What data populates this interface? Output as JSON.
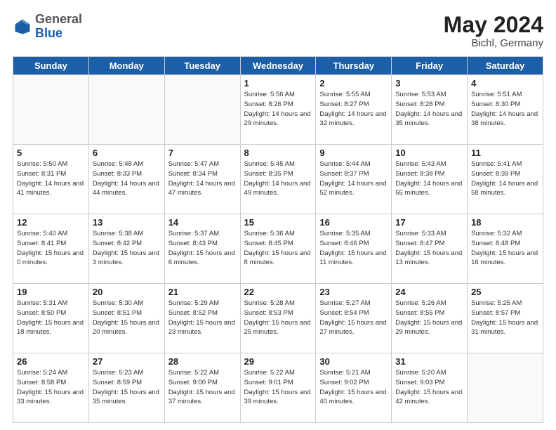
{
  "header": {
    "logo_general": "General",
    "logo_blue": "Blue",
    "month_title": "May 2024",
    "location": "Bichl, Germany"
  },
  "weekdays": [
    "Sunday",
    "Monday",
    "Tuesday",
    "Wednesday",
    "Thursday",
    "Friday",
    "Saturday"
  ],
  "weeks": [
    [
      {
        "day": "",
        "sunrise": "",
        "sunset": "",
        "daylight": ""
      },
      {
        "day": "",
        "sunrise": "",
        "sunset": "",
        "daylight": ""
      },
      {
        "day": "",
        "sunrise": "",
        "sunset": "",
        "daylight": ""
      },
      {
        "day": "1",
        "sunrise": "Sunrise: 5:56 AM",
        "sunset": "Sunset: 8:26 PM",
        "daylight": "Daylight: 14 hours and 29 minutes."
      },
      {
        "day": "2",
        "sunrise": "Sunrise: 5:55 AM",
        "sunset": "Sunset: 8:27 PM",
        "daylight": "Daylight: 14 hours and 32 minutes."
      },
      {
        "day": "3",
        "sunrise": "Sunrise: 5:53 AM",
        "sunset": "Sunset: 8:28 PM",
        "daylight": "Daylight: 14 hours and 35 minutes."
      },
      {
        "day": "4",
        "sunrise": "Sunrise: 5:51 AM",
        "sunset": "Sunset: 8:30 PM",
        "daylight": "Daylight: 14 hours and 38 minutes."
      }
    ],
    [
      {
        "day": "5",
        "sunrise": "Sunrise: 5:50 AM",
        "sunset": "Sunset: 8:31 PM",
        "daylight": "Daylight: 14 hours and 41 minutes."
      },
      {
        "day": "6",
        "sunrise": "Sunrise: 5:48 AM",
        "sunset": "Sunset: 8:33 PM",
        "daylight": "Daylight: 14 hours and 44 minutes."
      },
      {
        "day": "7",
        "sunrise": "Sunrise: 5:47 AM",
        "sunset": "Sunset: 8:34 PM",
        "daylight": "Daylight: 14 hours and 47 minutes."
      },
      {
        "day": "8",
        "sunrise": "Sunrise: 5:45 AM",
        "sunset": "Sunset: 8:35 PM",
        "daylight": "Daylight: 14 hours and 49 minutes."
      },
      {
        "day": "9",
        "sunrise": "Sunrise: 5:44 AM",
        "sunset": "Sunset: 8:37 PM",
        "daylight": "Daylight: 14 hours and 52 minutes."
      },
      {
        "day": "10",
        "sunrise": "Sunrise: 5:43 AM",
        "sunset": "Sunset: 8:38 PM",
        "daylight": "Daylight: 14 hours and 55 minutes."
      },
      {
        "day": "11",
        "sunrise": "Sunrise: 5:41 AM",
        "sunset": "Sunset: 8:39 PM",
        "daylight": "Daylight: 14 hours and 58 minutes."
      }
    ],
    [
      {
        "day": "12",
        "sunrise": "Sunrise: 5:40 AM",
        "sunset": "Sunset: 8:41 PM",
        "daylight": "Daylight: 15 hours and 0 minutes."
      },
      {
        "day": "13",
        "sunrise": "Sunrise: 5:38 AM",
        "sunset": "Sunset: 8:42 PM",
        "daylight": "Daylight: 15 hours and 3 minutes."
      },
      {
        "day": "14",
        "sunrise": "Sunrise: 5:37 AM",
        "sunset": "Sunset: 8:43 PM",
        "daylight": "Daylight: 15 hours and 6 minutes."
      },
      {
        "day": "15",
        "sunrise": "Sunrise: 5:36 AM",
        "sunset": "Sunset: 8:45 PM",
        "daylight": "Daylight: 15 hours and 8 minutes."
      },
      {
        "day": "16",
        "sunrise": "Sunrise: 5:35 AM",
        "sunset": "Sunset: 8:46 PM",
        "daylight": "Daylight: 15 hours and 11 minutes."
      },
      {
        "day": "17",
        "sunrise": "Sunrise: 5:33 AM",
        "sunset": "Sunset: 8:47 PM",
        "daylight": "Daylight: 15 hours and 13 minutes."
      },
      {
        "day": "18",
        "sunrise": "Sunrise: 5:32 AM",
        "sunset": "Sunset: 8:48 PM",
        "daylight": "Daylight: 15 hours and 16 minutes."
      }
    ],
    [
      {
        "day": "19",
        "sunrise": "Sunrise: 5:31 AM",
        "sunset": "Sunset: 8:50 PM",
        "daylight": "Daylight: 15 hours and 18 minutes."
      },
      {
        "day": "20",
        "sunrise": "Sunrise: 5:30 AM",
        "sunset": "Sunset: 8:51 PM",
        "daylight": "Daylight: 15 hours and 20 minutes."
      },
      {
        "day": "21",
        "sunrise": "Sunrise: 5:29 AM",
        "sunset": "Sunset: 8:52 PM",
        "daylight": "Daylight: 15 hours and 23 minutes."
      },
      {
        "day": "22",
        "sunrise": "Sunrise: 5:28 AM",
        "sunset": "Sunset: 8:53 PM",
        "daylight": "Daylight: 15 hours and 25 minutes."
      },
      {
        "day": "23",
        "sunrise": "Sunrise: 5:27 AM",
        "sunset": "Sunset: 8:54 PM",
        "daylight": "Daylight: 15 hours and 27 minutes."
      },
      {
        "day": "24",
        "sunrise": "Sunrise: 5:26 AM",
        "sunset": "Sunset: 8:55 PM",
        "daylight": "Daylight: 15 hours and 29 minutes."
      },
      {
        "day": "25",
        "sunrise": "Sunrise: 5:25 AM",
        "sunset": "Sunset: 8:57 PM",
        "daylight": "Daylight: 15 hours and 31 minutes."
      }
    ],
    [
      {
        "day": "26",
        "sunrise": "Sunrise: 5:24 AM",
        "sunset": "Sunset: 8:58 PM",
        "daylight": "Daylight: 15 hours and 33 minutes."
      },
      {
        "day": "27",
        "sunrise": "Sunrise: 5:23 AM",
        "sunset": "Sunset: 8:59 PM",
        "daylight": "Daylight: 15 hours and 35 minutes."
      },
      {
        "day": "28",
        "sunrise": "Sunrise: 5:22 AM",
        "sunset": "Sunset: 9:00 PM",
        "daylight": "Daylight: 15 hours and 37 minutes."
      },
      {
        "day": "29",
        "sunrise": "Sunrise: 5:22 AM",
        "sunset": "Sunset: 9:01 PM",
        "daylight": "Daylight: 15 hours and 39 minutes."
      },
      {
        "day": "30",
        "sunrise": "Sunrise: 5:21 AM",
        "sunset": "Sunset: 9:02 PM",
        "daylight": "Daylight: 15 hours and 40 minutes."
      },
      {
        "day": "31",
        "sunrise": "Sunrise: 5:20 AM",
        "sunset": "Sunset: 9:03 PM",
        "daylight": "Daylight: 15 hours and 42 minutes."
      },
      {
        "day": "",
        "sunrise": "",
        "sunset": "",
        "daylight": ""
      }
    ]
  ]
}
